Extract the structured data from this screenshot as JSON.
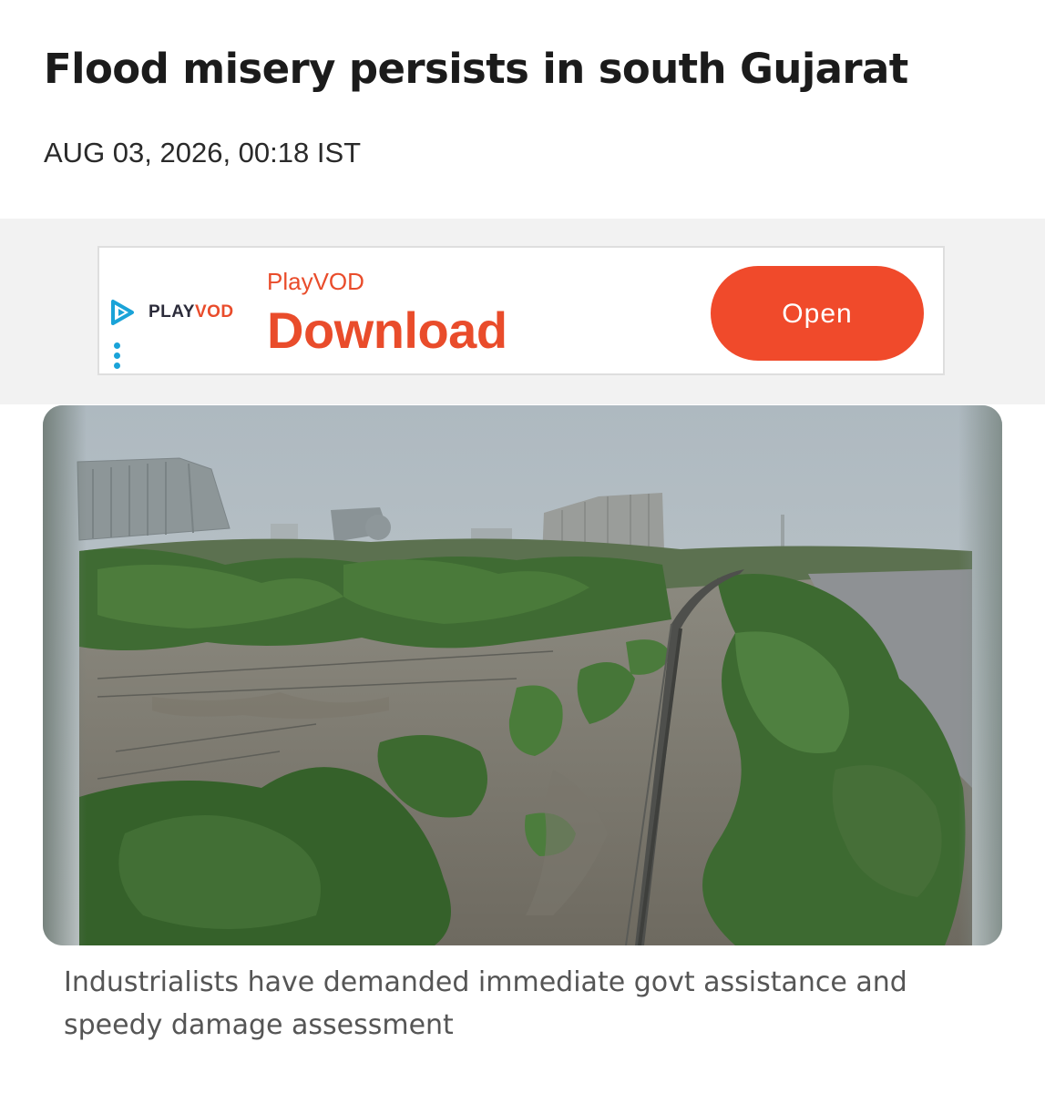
{
  "article": {
    "headline": "Flood misery persists in south Gujarat",
    "dateline": "AUG 03, 2026, 00:18 IST",
    "caption": "Industrialists have demanded immediate govt assistance and speedy damage assessment"
  },
  "ad": {
    "logo_text_main": "PLAY",
    "logo_text_accent": "VOD",
    "brand": "PlayVOD",
    "headline": "Download",
    "cta_label": "Open",
    "icons": [
      "play-logo-icon",
      "kebab-menu-icon"
    ],
    "colors": {
      "accent": "#e94c2b",
      "button": "#f04a2b",
      "logo_blue": "#1aa3d8"
    }
  },
  "image": {
    "subject": "flooded-park-photo"
  }
}
